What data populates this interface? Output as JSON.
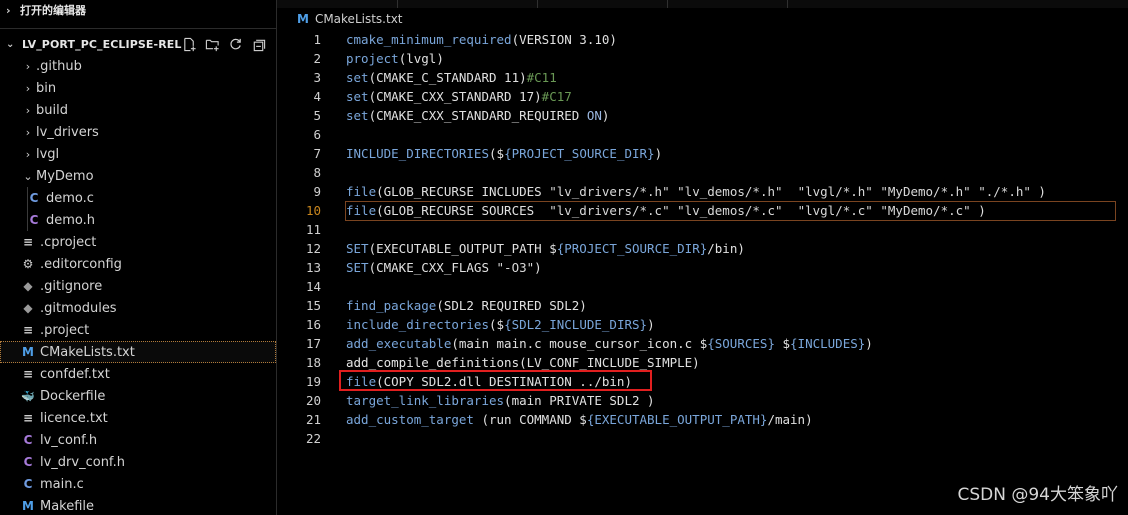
{
  "sidebar": {
    "open_editors_label": "打开的编辑器",
    "project_title": "LV_PORT_PC_ECLIPSE-RELE...",
    "items": [
      {
        "label": ".github",
        "type": "folder",
        "expanded": false,
        "indent": 1
      },
      {
        "label": "bin",
        "type": "folder",
        "expanded": false,
        "indent": 1
      },
      {
        "label": "build",
        "type": "folder",
        "expanded": false,
        "indent": 1
      },
      {
        "label": "lv_drivers",
        "type": "folder",
        "expanded": false,
        "indent": 1
      },
      {
        "label": "lvgl",
        "type": "folder",
        "expanded": false,
        "indent": 1
      },
      {
        "label": "MyDemo",
        "type": "folder",
        "expanded": true,
        "indent": 1
      },
      {
        "label": "demo.c",
        "type": "c",
        "indent": 2
      },
      {
        "label": "demo.h",
        "type": "h",
        "indent": 2
      },
      {
        "label": ".cproject",
        "type": "lines",
        "indent": 1
      },
      {
        "label": ".editorconfig",
        "type": "gear",
        "indent": 1
      },
      {
        "label": ".gitignore",
        "type": "git",
        "indent": 1
      },
      {
        "label": ".gitmodules",
        "type": "git",
        "indent": 1
      },
      {
        "label": ".project",
        "type": "lines",
        "indent": 1
      },
      {
        "label": "CMakeLists.txt",
        "type": "cmake",
        "indent": 1,
        "selected": true
      },
      {
        "label": "confdef.txt",
        "type": "lines",
        "indent": 1
      },
      {
        "label": "Dockerfile",
        "type": "docker",
        "indent": 1
      },
      {
        "label": "licence.txt",
        "type": "lines",
        "indent": 1
      },
      {
        "label": "lv_conf.h",
        "type": "h",
        "indent": 1
      },
      {
        "label": "lv_drv_conf.h",
        "type": "h",
        "indent": 1
      },
      {
        "label": "main.c",
        "type": "c",
        "indent": 1
      },
      {
        "label": "Makefile",
        "type": "cmake",
        "indent": 1
      }
    ]
  },
  "editor": {
    "breadcrumb": "CMakeLists.txt",
    "current_line": 10,
    "highlighted_line": 19,
    "lines": [
      {
        "n": "1",
        "t": "cmake_minimum_required(VERSION 3.10)"
      },
      {
        "n": "2",
        "t": "project(lvgl)"
      },
      {
        "n": "3",
        "t": "set(CMAKE_C_STANDARD 11)#C11"
      },
      {
        "n": "4",
        "t": "set(CMAKE_CXX_STANDARD 17)#C17"
      },
      {
        "n": "5",
        "t": "set(CMAKE_CXX_STANDARD_REQUIRED ON)"
      },
      {
        "n": "6",
        "t": ""
      },
      {
        "n": "7",
        "t": "INCLUDE_DIRECTORIES(${PROJECT_SOURCE_DIR})"
      },
      {
        "n": "8",
        "t": ""
      },
      {
        "n": "9",
        "t": "file(GLOB_RECURSE INCLUDES \"lv_drivers/*.h\" \"lv_demos/*.h\"  \"lvgl/*.h\" \"MyDemo/*.h\" \"./*.h\" )"
      },
      {
        "n": "10",
        "t": "file(GLOB_RECURSE SOURCES  \"lv_drivers/*.c\" \"lv_demos/*.c\"  \"lvgl/*.c\" \"MyDemo/*.c\" )"
      },
      {
        "n": "11",
        "t": ""
      },
      {
        "n": "12",
        "t": "SET(EXECUTABLE_OUTPUT_PATH ${PROJECT_SOURCE_DIR}/bin)"
      },
      {
        "n": "13",
        "t": "SET(CMAKE_CXX_FLAGS \"-O3\")"
      },
      {
        "n": "14",
        "t": ""
      },
      {
        "n": "15",
        "t": "find_package(SDL2 REQUIRED SDL2)"
      },
      {
        "n": "16",
        "t": "include_directories(${SDL2_INCLUDE_DIRS})"
      },
      {
        "n": "17",
        "t": "add_executable(main main.c mouse_cursor_icon.c ${SOURCES} ${INCLUDES})"
      },
      {
        "n": "18",
        "t": "add_compile_definitions(LV_CONF_INCLUDE_SIMPLE)"
      },
      {
        "n": "19",
        "t": "file(COPY SDL2.dll DESTINATION ../bin)"
      },
      {
        "n": "20",
        "t": "target_link_libraries(main PRIVATE SDL2 )"
      },
      {
        "n": "21",
        "t": "add_custom_target (run COMMAND ${EXECUTABLE_OUTPUT_PATH}/main)"
      },
      {
        "n": "22",
        "t": ""
      }
    ]
  },
  "watermark": "CSDN @94大笨象吖",
  "colors": {
    "accent_orange": "#c8861e",
    "highlight_red": "#e11f1f",
    "cmake_blue": "#4f9fe8"
  }
}
